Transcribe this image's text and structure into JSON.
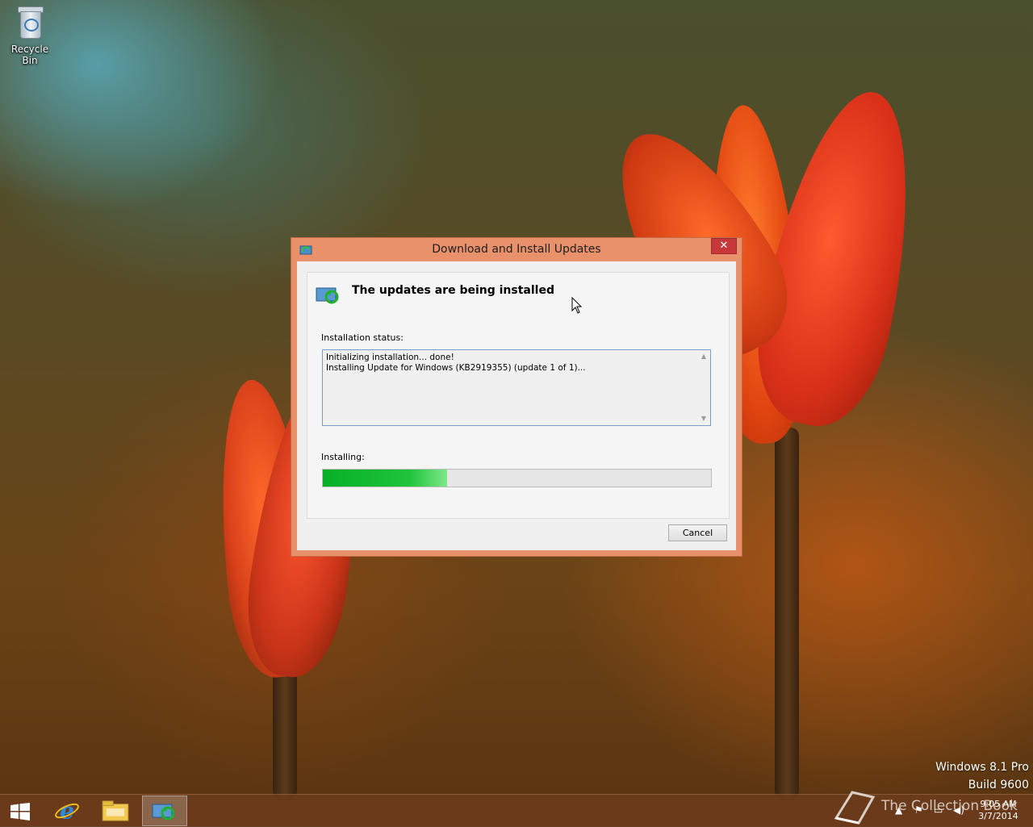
{
  "desktop": {
    "recycle_bin_label": "Recycle Bin",
    "watermark": {
      "line1": "Windows 8.1 Pro",
      "line2": "Build 9600"
    }
  },
  "dialog": {
    "title": "Download and Install Updates",
    "close_label": "✕",
    "header": "The updates are being installed",
    "status_label": "Installation status:",
    "log_lines": [
      "Initializing installation... done!",
      "Installing Update for Windows (KB2919355) (update 1 of 1)..."
    ],
    "installing_label": "Installing:",
    "progress_fraction": 0.32,
    "cancel_label": "Cancel"
  },
  "taskbar": {
    "clock_time": "9:05 AM",
    "clock_date": "3/7/2014",
    "watermark_brand": "The Collection Book"
  },
  "colors": {
    "titlebar": "#e8916a",
    "close": "#c7383a",
    "progress": "#06b025"
  },
  "icons": {
    "start": "windows-logo-icon",
    "ie": "internet-explorer-icon",
    "explorer": "file-explorer-icon",
    "update": "windows-update-icon"
  }
}
